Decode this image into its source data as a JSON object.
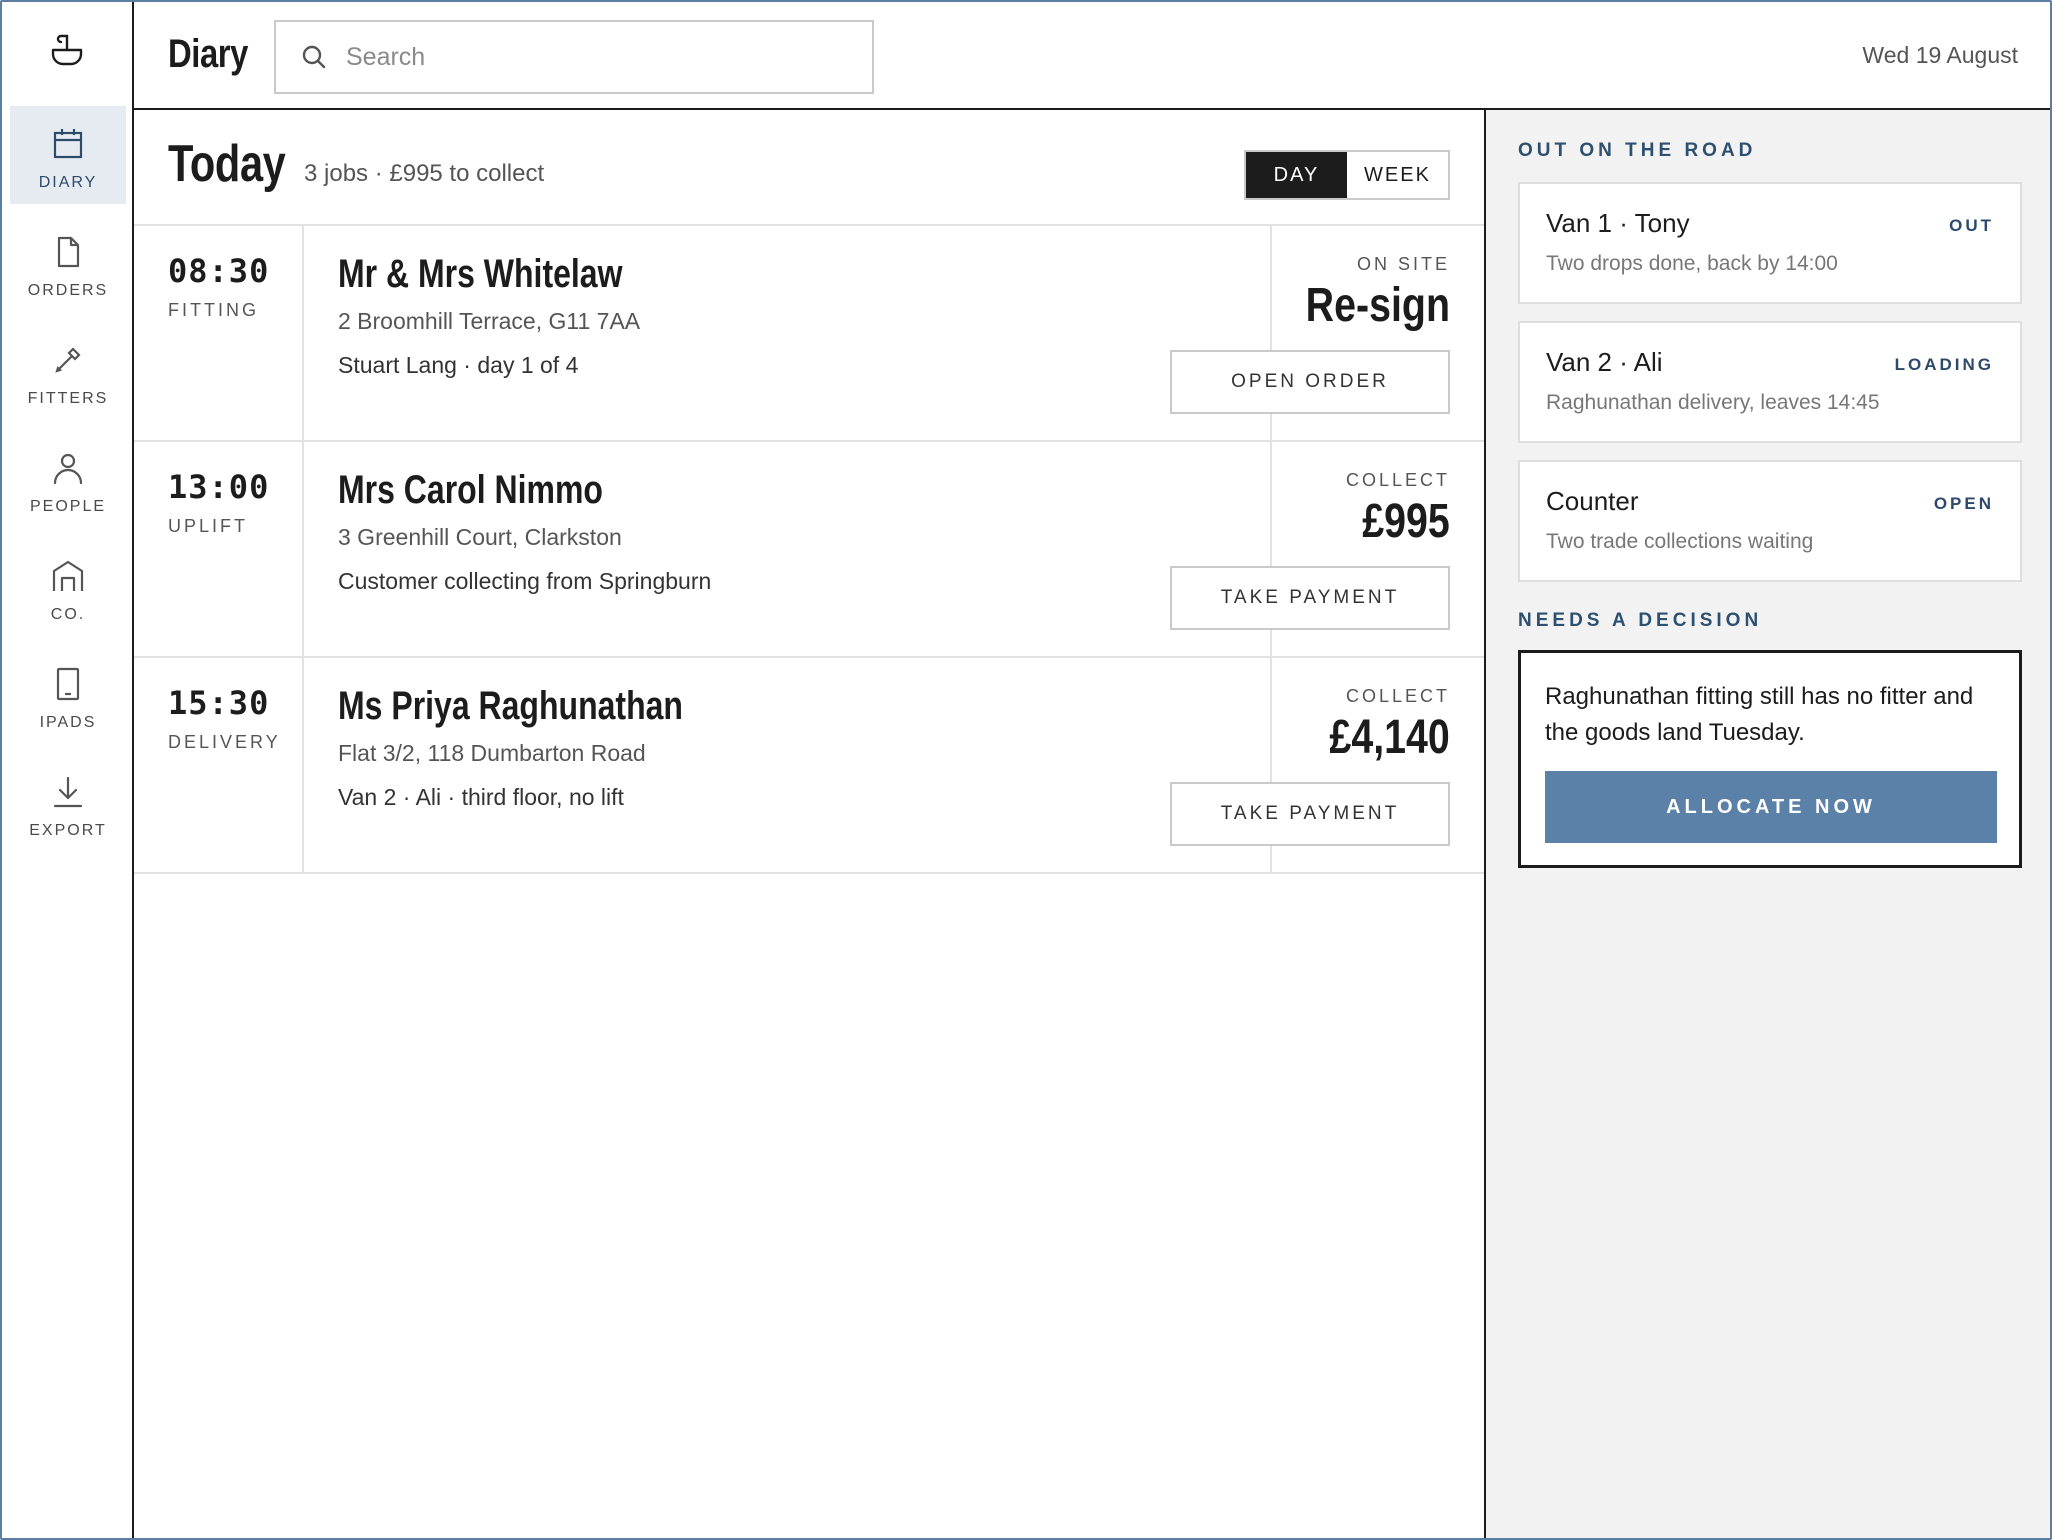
{
  "app": {
    "title": "Diary",
    "date": "Wed 19 August"
  },
  "search": {
    "placeholder": "Search"
  },
  "sidebar": {
    "items": [
      {
        "label": "DIARY",
        "icon": "calendar-icon",
        "active": true
      },
      {
        "label": "ORDERS",
        "icon": "document-icon"
      },
      {
        "label": "FITTERS",
        "icon": "tool-icon"
      },
      {
        "label": "PEOPLE",
        "icon": "person-icon"
      },
      {
        "label": "CO.",
        "icon": "building-icon"
      },
      {
        "label": "IPADS",
        "icon": "tablet-icon"
      },
      {
        "label": "EXPORT",
        "icon": "download-icon"
      }
    ]
  },
  "today": {
    "title": "Today",
    "summary": "3 jobs · £995 to collect",
    "toggle": {
      "day": "DAY",
      "week": "WEEK",
      "selected": "DAY"
    }
  },
  "jobs": [
    {
      "time": "08:30",
      "kind": "FITTING",
      "name": "Mr & Mrs Whitelaw",
      "address": "2 Broomhill Terrace, G11 7AA",
      "note": "Stuart Lang · day 1 of 4",
      "status": "ON SITE",
      "value": "Re-sign",
      "action": "OPEN ORDER"
    },
    {
      "time": "13:00",
      "kind": "UPLIFT",
      "name": "Mrs Carol Nimmo",
      "address": "3 Greenhill Court, Clarkston",
      "note": "Customer collecting from Springburn",
      "status": "COLLECT",
      "value": "£995",
      "action": "TAKE PAYMENT"
    },
    {
      "time": "15:30",
      "kind": "DELIVERY",
      "name": "Ms Priya Raghunathan",
      "address": "Flat 3/2, 118 Dumbarton Road",
      "note": "Van 2 · Ali · third floor, no lift",
      "status": "COLLECT",
      "value": "£4,140",
      "action": "TAKE PAYMENT"
    }
  ],
  "panel": {
    "road_title": "OUT ON THE ROAD",
    "road": [
      {
        "name": "Van 1 · Tony",
        "state": "OUT",
        "desc": "Two drops done, back by 14:00"
      },
      {
        "name": "Van 2 · Ali",
        "state": "LOADING",
        "desc": "Raghunathan delivery, leaves 14:45"
      },
      {
        "name": "Counter",
        "state": "OPEN",
        "desc": "Two trade collections waiting"
      }
    ],
    "decision_title": "NEEDS A DECISION",
    "decision": {
      "text": "Raghunathan fitting still has no fitter and the goods land Tuesday.",
      "action": "ALLOCATE NOW"
    }
  },
  "colors": {
    "accent": "#5b81a8",
    "active_nav": "#e6ebf1",
    "heading_blue": "#2d5070",
    "ink": "#1c1c1c"
  }
}
